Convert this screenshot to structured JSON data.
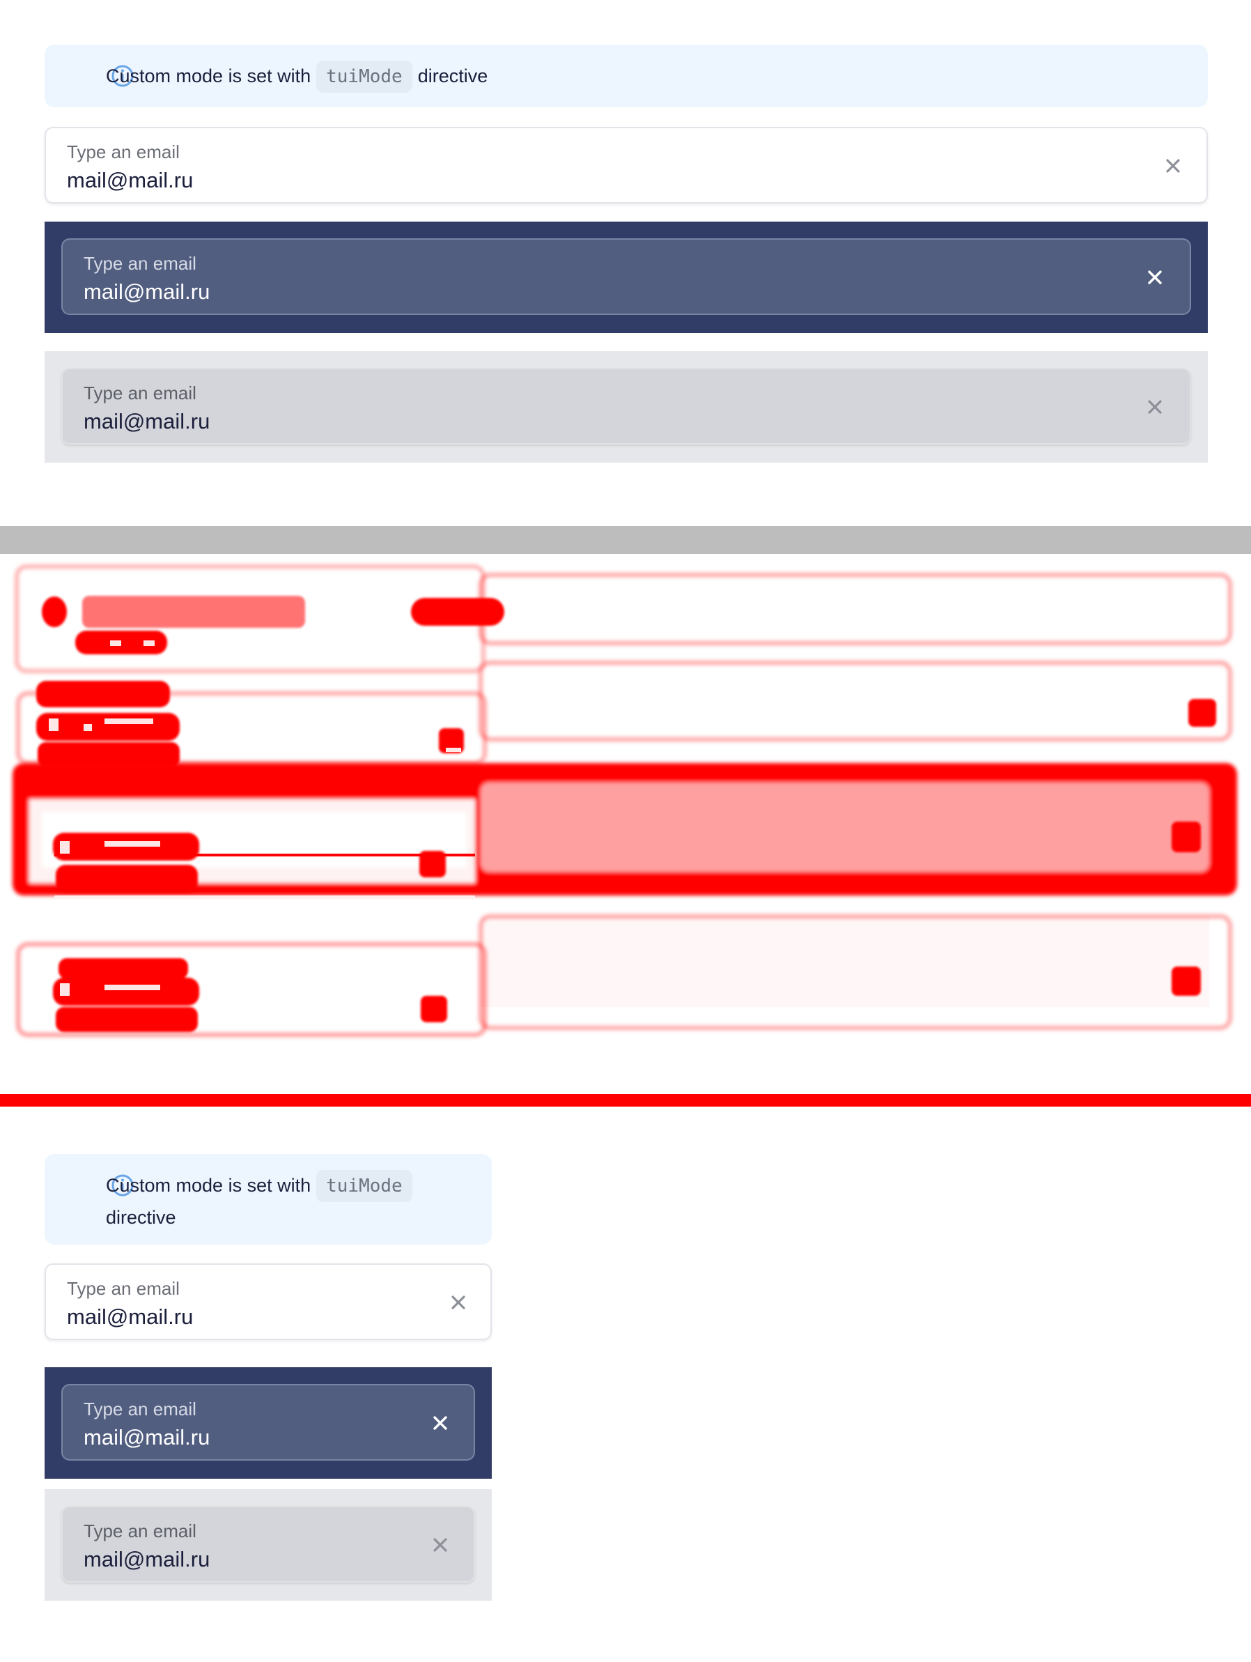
{
  "examples": [
    {
      "notification": {
        "text_before": "Custom mode is set with",
        "code": "tuiMode",
        "text_after": "directive"
      },
      "fields": [
        {
          "mode": "default",
          "label": "Type an email",
          "value": "mail@mail.ru"
        },
        {
          "mode": "dark",
          "label": "Type an email",
          "value": "mail@mail.ru"
        },
        {
          "mode": "gray",
          "label": "Type an email",
          "value": "mail@mail.ru"
        }
      ]
    },
    {
      "notification": {
        "text_before": "Custom mode is set with",
        "code": "tuiMode",
        "text_after": "directive"
      },
      "fields": [
        {
          "mode": "default",
          "label": "Type an email",
          "value": "mail@mail.ru"
        },
        {
          "mode": "dark",
          "label": "Type an email",
          "value": "mail@mail.ru"
        },
        {
          "mode": "gray",
          "label": "Type an email",
          "value": "mail@mail.ru"
        }
      ]
    }
  ],
  "colors": {
    "notification_bg": "#edf6ff",
    "info_icon": "#6aa6e6",
    "dark_mode_bg": "#313d66",
    "gray_mode_bg": "#e6e7ea",
    "diff_highlight": "#ff0000",
    "separator": "#bdbdbd"
  },
  "icons": {
    "info": "info-circle-icon",
    "clear": "close-icon"
  }
}
